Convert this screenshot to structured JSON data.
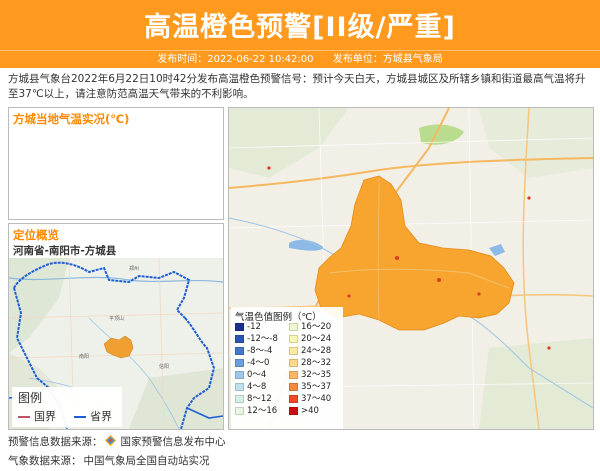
{
  "header": {
    "title": "高温橙色预警[II级/严重]",
    "issue_time_label": "发布时间：2022-06-22 10:42:00",
    "issuer_label": "发布单位：方城县气象局",
    "bg_color": "#ff9a1f"
  },
  "summary": "方城县气象台2022年6月22日10时42分发布高温橙色预警信号：预计今天白天，方城县城区及所辖乡镇和街道最高气温将升至37℃以上，请注意防范高温天气带来的不利影响。",
  "left_top_panel": {
    "title": "方城当地气温实况(℃)"
  },
  "location_panel": {
    "title": "定位概览",
    "path": "河南省-南阳市-方城县"
  },
  "map_legend": {
    "title": "图例",
    "items": [
      {
        "label": "国界",
        "color": "#c0526a"
      },
      {
        "label": "省界",
        "color": "#1f5fd6"
      }
    ]
  },
  "temperature_legend": {
    "title": "气温色值图例（℃）",
    "items": [
      {
        "label": "-12",
        "color": "#1c2e8e"
      },
      {
        "label": "-12～-8",
        "color": "#2c56b3"
      },
      {
        "label": "-8～-4",
        "color": "#4576cc"
      },
      {
        "label": "-4～0",
        "color": "#6c9de0"
      },
      {
        "label": "0～4",
        "color": "#9fc7ec"
      },
      {
        "label": "4～8",
        "color": "#bfe0ef"
      },
      {
        "label": "8～12",
        "color": "#d6efe6"
      },
      {
        "label": "12～16",
        "color": "#e8f5e0"
      },
      {
        "label": "16～20",
        "color": "#eef7cf"
      },
      {
        "label": "20～24",
        "color": "#f6f6b5"
      },
      {
        "label": "24～28",
        "color": "#fbeaa0"
      },
      {
        "label": "28～32",
        "color": "#fdd98a"
      },
      {
        "label": "32～35",
        "color": "#fcb764"
      },
      {
        "label": "35～37",
        "color": "#f7893f"
      },
      {
        "label": "37～40",
        "color": "#ee4a2a"
      },
      {
        "label": ">40",
        "color": "#c80f14"
      }
    ]
  },
  "sources": {
    "warning_label": "预警信息数据来源：",
    "warning_value": "国家预警信息发布中心",
    "weather_label": "气象数据来源：",
    "weather_value": "中国气象局全国自动站实况"
  }
}
